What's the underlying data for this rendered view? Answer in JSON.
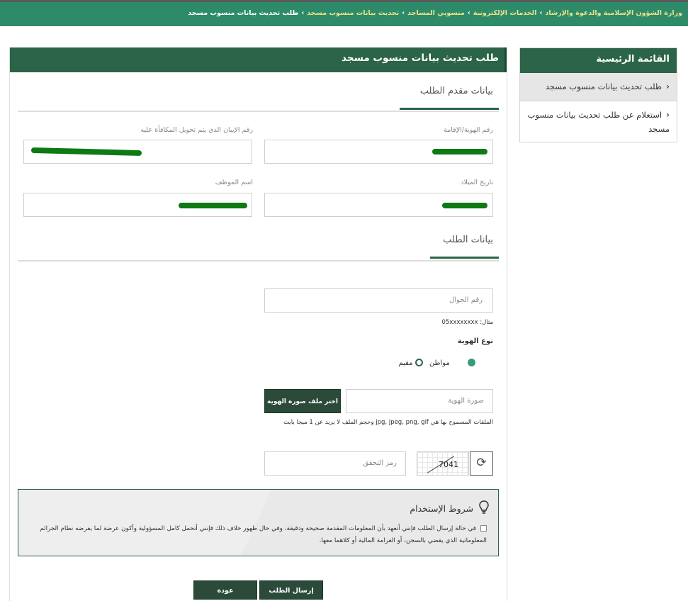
{
  "breadcrumb": {
    "items": [
      "وزارة الشؤون الإسلامية والدعوة والإرشاد",
      "الخدمات الإلكترونية",
      "منسوبي المساجد",
      "تحديث بيانات منسوب مسجد"
    ],
    "current": "طلب تحديث بيانات منسوب مسجد",
    "separator": "›"
  },
  "sidebar": {
    "title": "القائمة الرئيسية",
    "items": [
      {
        "label": "طلب تحديث بيانات منسوب مسجد"
      },
      {
        "label": "استعلام عن طلب تحديث بيانات منسوب مسجد"
      }
    ]
  },
  "main": {
    "title": "طلب تحديث بيانات منسوب مسجد",
    "applicant_section": "بيانات مقدم الطلب",
    "labels": {
      "id_number": "رقم الهوية/الإقامة",
      "iban": "رقم الإيبان الذي يتم تحويل المكافأة عليه",
      "birth_date": "تاريخ الميلاد",
      "employee_name": "اسم الموظف"
    },
    "request_section": "بيانات الطلب",
    "mobile_placeholder": "رقم الجوال",
    "mobile_hint": "مثال: 05xxxxxxxx",
    "id_type_label": "نوع الهوية",
    "id_type_options": [
      "مواطن",
      "مقيم"
    ],
    "id_type_selected": "مواطن",
    "id_image_placeholder": "صورة الهوية",
    "choose_file_button": "اختر ملف صورة الهوية",
    "file_hint": "الملفات المسموح بها هي jpg, jpeg, png, gif وحجم الملف لا يزيد عن 1 ميجا بايت",
    "captcha_placeholder": "رمز التحقق",
    "captcha_value": "7041"
  },
  "terms": {
    "title": "شروط الإستخدام",
    "text": "في حالة إرسال الطلب فإنني أتعهد بأن المعلومات المقدمة صحيحة ودقيقة، وفي حال ظهور خلاف ذلك فإنني أتحمل كامل المسؤولية وأكون عرضة لما يفرضه نظام الجرائم المعلوماتية الذي يقضي بالسجن، أو الغرامة المالية أو كلاهما معها."
  },
  "actions": {
    "submit": "إرسال الطلب",
    "back": "عودة"
  },
  "colors": {
    "topbar": "#2e8b6a",
    "header": "#2b6448",
    "button": "#2b4a3a",
    "redaction": "#0d7a13"
  }
}
